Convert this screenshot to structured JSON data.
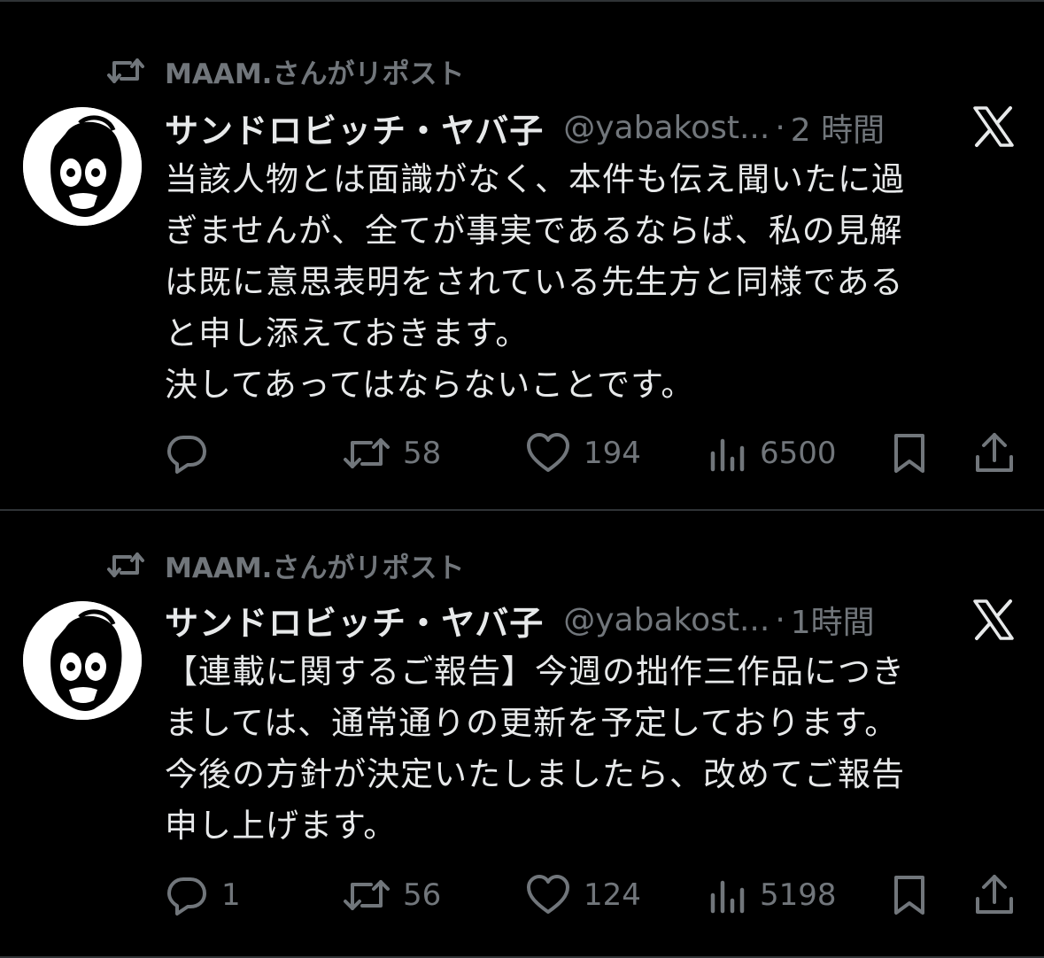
{
  "tweets": [
    {
      "repost_label": "MAAM.さんがリポスト",
      "display_name": "サンドロビッチ・ヤバ子",
      "handle": "@yabakost...",
      "separator": "·",
      "time": "2 時間",
      "text": "当該人物とは面識がなく、本件も伝え聞いたに過\nぎませんが、全てが事実であるならば、私の見解\nは既に意思表明をされている先生方と同様である\nと申し添えておきます。\n決してあってはならないことです。",
      "replies": "",
      "reposts": "58",
      "likes": "194",
      "views": "6500"
    },
    {
      "repost_label": "MAAM.さんがリポスト",
      "display_name": "サンドロビッチ・ヤバ子",
      "handle": "@yabakost...",
      "separator": "·",
      "time": "1時間",
      "text": "【連載に関するご報告】今週の拙作三作品につき\nましては、通常通りの更新を予定しております。\n今後の方針が決定いたしましたら、改めてご報告\n申し上げます。",
      "replies": "1",
      "reposts": "56",
      "likes": "124",
      "views": "5198"
    }
  ],
  "icons": {
    "repost": "repost-icon",
    "reply": "reply-icon",
    "like": "heart-icon",
    "views": "views-icon",
    "bookmark": "bookmark-icon",
    "share": "share-icon",
    "platform": "x-logo-icon"
  },
  "colors": {
    "background": "#000000",
    "text": "#e7e9ea",
    "muted": "#71767b",
    "divider": "#2f3336"
  }
}
